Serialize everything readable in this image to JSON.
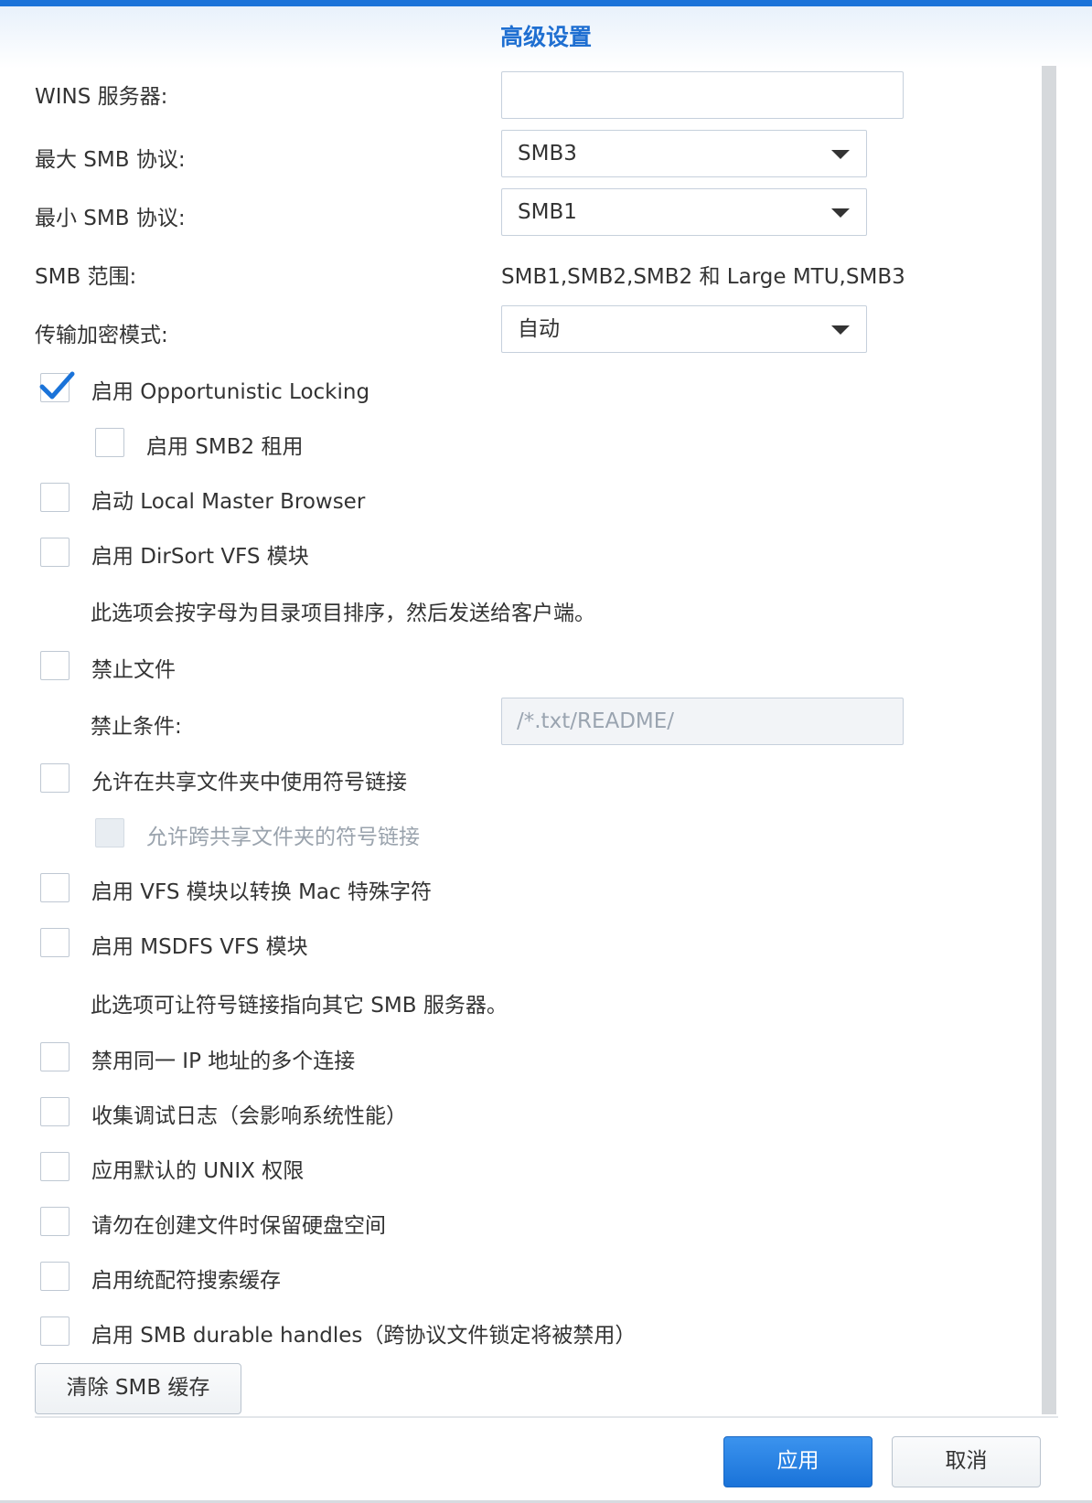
{
  "dialog": {
    "title": "高级设置"
  },
  "fields": {
    "wins_label": "WINS 服务器:",
    "wins_value": "",
    "max_smb_label": "最大 SMB 协议:",
    "max_smb_value": "SMB3",
    "min_smb_label": "最小 SMB 协议:",
    "min_smb_value": "SMB1",
    "smb_range_label": "SMB 范围:",
    "smb_range_value": "SMB1,SMB2,SMB2 和 Large MTU,SMB3",
    "encryption_label": "传输加密模式:",
    "encryption_value": "自动"
  },
  "options": {
    "oplocks": {
      "label": "启用 Opportunistic Locking",
      "checked": true
    },
    "smb2_leases": {
      "label": "启用 SMB2 租用",
      "checked": false
    },
    "local_master": {
      "label": "启动 Local Master Browser",
      "checked": false
    },
    "dirsort": {
      "label": "启用 DirSort VFS 模块",
      "checked": false
    },
    "dirsort_desc": "此选项会按字母为目录项目排序，然后发送给客户端。",
    "veto_files": {
      "label": "禁止文件",
      "checked": false
    },
    "veto_condition_label": "禁止条件:",
    "veto_condition_placeholder": "/*.txt/README/",
    "symlinks": {
      "label": "允许在共享文件夹中使用符号链接",
      "checked": false
    },
    "cross_share_symlinks": {
      "label": "允许跨共享文件夹的符号链接",
      "checked": false,
      "disabled": true
    },
    "mac_chars": {
      "label": "启用 VFS 模块以转换 Mac 特殊字符",
      "checked": false
    },
    "msdfs": {
      "label": "启用 MSDFS VFS 模块",
      "checked": false
    },
    "msdfs_desc": "此选项可让符号链接指向其它 SMB 服务器。",
    "same_ip": {
      "label": "禁用同一 IP 地址的多个连接",
      "checked": false
    },
    "debug_log": {
      "label": "收集调试日志（会影响系统性能）",
      "checked": false
    },
    "unix_perms": {
      "label": "应用默认的 UNIX 权限",
      "checked": false
    },
    "reserve_space": {
      "label": "请勿在创建文件时保留硬盘空间",
      "checked": false
    },
    "wildcard_cache": {
      "label": "启用统配符搜索缓存",
      "checked": false
    },
    "durable_handles": {
      "label": "启用 SMB durable handles（跨协议文件锁定将被禁用）",
      "checked": false
    }
  },
  "buttons": {
    "clear_cache": "清除 SMB 缓存",
    "apply": "应用",
    "cancel": "取消"
  },
  "colors": {
    "accent": "#1a73d9",
    "title": "#1f6fd1",
    "checkmark": "#1a73d9"
  }
}
